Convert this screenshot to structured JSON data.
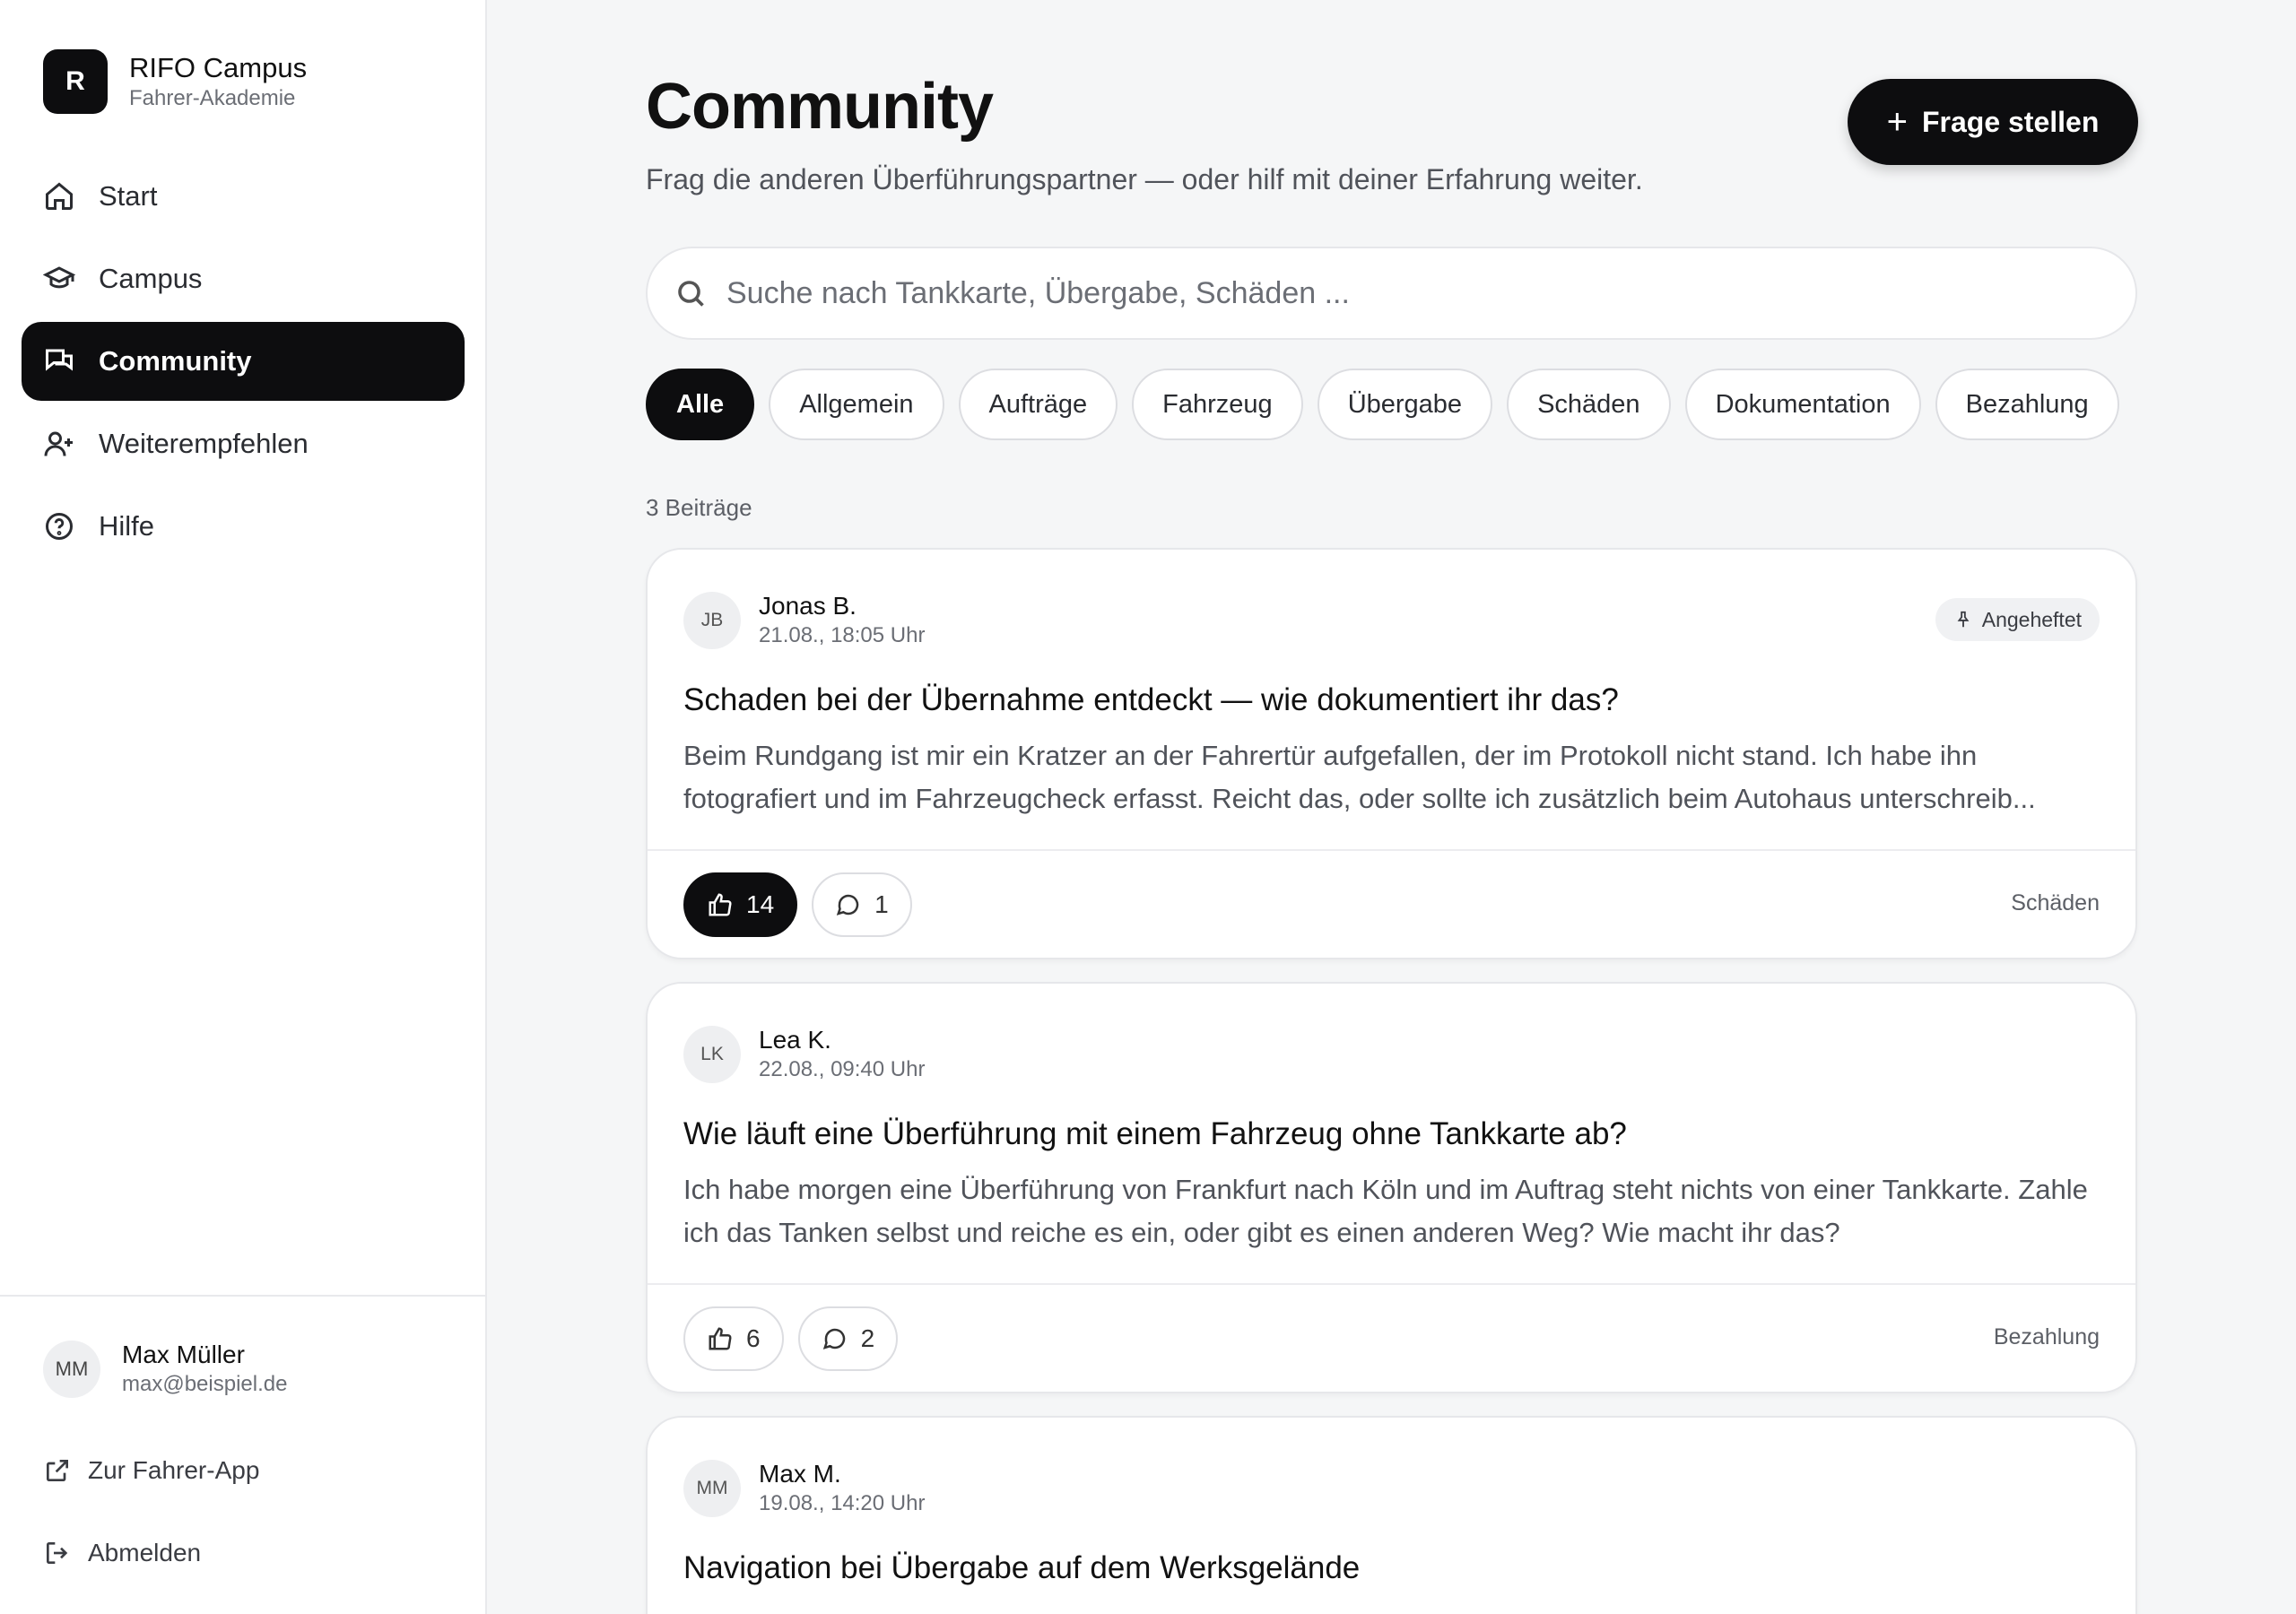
{
  "brand": {
    "logo_letter": "R",
    "title": "RIFO Campus",
    "subtitle": "Fahrer-Akademie"
  },
  "nav": [
    {
      "label": "Start",
      "icon": "home-icon"
    },
    {
      "label": "Campus",
      "icon": "graduation-cap-icon"
    },
    {
      "label": "Community",
      "icon": "chat-bubbles-icon",
      "active": true
    },
    {
      "label": "Weiterempfehlen",
      "icon": "user-plus-icon"
    },
    {
      "label": "Hilfe",
      "icon": "help-circle-icon"
    }
  ],
  "user": {
    "initials": "MM",
    "name": "Max Müller",
    "email": "max@beispiel.de"
  },
  "footer_links": {
    "driver_app": "Zur Fahrer-App",
    "logout": "Abmelden"
  },
  "main": {
    "title": "Community",
    "subtitle": "Frag die anderen Überführungspartner — oder hilf mit deiner Erfahrung weiter.",
    "ask_button": "Frage stellen",
    "search_placeholder": "Suche nach Tankkarte, Übergabe, Schäden ...",
    "filters": [
      "Alle",
      "Allgemein",
      "Aufträge",
      "Fahrzeug",
      "Übergabe",
      "Schäden",
      "Dokumentation",
      "Bezahlung"
    ],
    "active_filter": "Alle",
    "count": "3 Beiträge"
  },
  "posts": [
    {
      "initials": "JB",
      "author": "Jonas B.",
      "date": "21.08., 18:05 Uhr",
      "pinned_label": "Angeheftet",
      "title": "Schaden bei der Übernahme entdeckt — wie dokumentiert ihr das?",
      "body": "Beim Rundgang ist mir ein Kratzer an der Fahrertür aufgefallen, der im Protokoll nicht stand. Ich habe ihn fotografiert und im Fahrzeugcheck erfasst. Reicht das, oder sollte ich zusätzlich beim Autohaus unterschreib...",
      "likes": "14",
      "comments": "1",
      "category": "Schäden",
      "liked": true
    },
    {
      "initials": "LK",
      "author": "Lea K.",
      "date": "22.08., 09:40 Uhr",
      "title": "Wie läuft eine Überführung mit einem Fahrzeug ohne Tankkarte ab?",
      "body": "Ich habe morgen eine Überführung von Frankfurt nach Köln und im Auftrag steht nichts von einer Tankkarte. Zahle ich das Tanken selbst und reiche es ein, oder gibt es einen anderen Weg? Wie macht ihr das?",
      "likes": "6",
      "comments": "2",
      "category": "Bezahlung",
      "liked": false
    },
    {
      "initials": "MM",
      "author": "Max M.",
      "date": "19.08., 14:20 Uhr",
      "title": "Navigation bei Übergabe auf dem Werksgelände"
    }
  ]
}
